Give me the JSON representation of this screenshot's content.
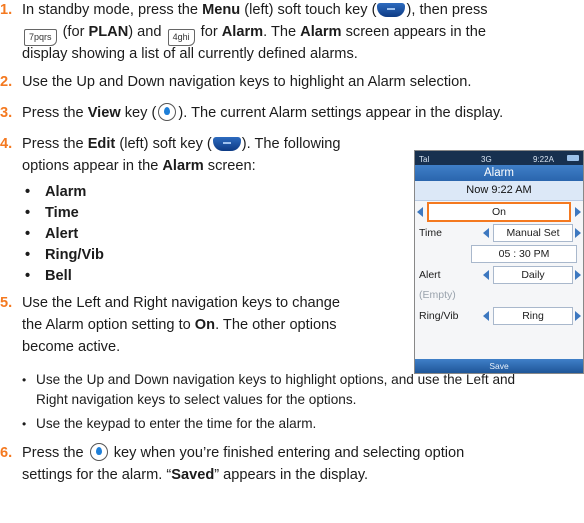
{
  "steps": [
    {
      "num": "1.",
      "l1": [
        "In standby mode, press the ",
        "Menu",
        " (left) soft touch key (",
        "), then press"
      ],
      "l2": [
        " (for ",
        "PLAN",
        ") and ",
        " for ",
        "Alarm",
        ". The ",
        "Alarm",
        " screen appears in the"
      ],
      "l3": "display showing a list of all currently defined alarms.",
      "key7": "7pqrs",
      "key4": "4ghi"
    },
    {
      "num": "2.",
      "text": "Use the Up and Down navigation keys to highlight an Alarm selection."
    },
    {
      "num": "3.",
      "parts": [
        "Press the ",
        "View",
        " key (",
        "). The current Alarm settings appear in the display."
      ]
    },
    {
      "num": "4.",
      "l1": [
        "Press the ",
        "Edit",
        " (left) soft key (",
        "). The following"
      ],
      "l2": [
        "options appear in the ",
        "Alarm",
        " screen:"
      ]
    },
    {
      "num": "5.",
      "l1": "Use the Left and Right navigation keys to change",
      "l2": [
        "the Alarm option setting to ",
        "On",
        ". The other options"
      ],
      "l3": "become active."
    },
    {
      "num": "6.",
      "l1": [
        "Press the ",
        " key when you’re finished entering and selecting option"
      ],
      "l2": [
        "settings for the alarm. “",
        "Saved",
        "” appears in the display."
      ]
    }
  ],
  "bullets": [
    "Alarm",
    "Time",
    "Alert",
    "Ring/Vib",
    "Bell"
  ],
  "bullet_dot": "•",
  "sub_bullets": [
    "Use the Up and Down navigation keys to highlight options, and use the Left and",
    "Right navigation keys to select values for the options.",
    "Use the keypad to enter the time for the alarm."
  ],
  "phone": {
    "status_left": "Tal",
    "status_mid": "3G",
    "status_time": "9:22A",
    "title": "Alarm",
    "now": "Now 9:22 AM",
    "on": "On",
    "time_label": "Time",
    "time_mode": "Manual Set",
    "time_value": "05 : 30 PM",
    "alert_label": "Alert",
    "alert_value": "Daily",
    "empty": "(Empty)",
    "ring_label": "Ring/Vib",
    "ring_value": "Ring",
    "save": "Save"
  },
  "colors": {
    "accent": "#f47920",
    "phone_blue": "#2a65ad"
  }
}
